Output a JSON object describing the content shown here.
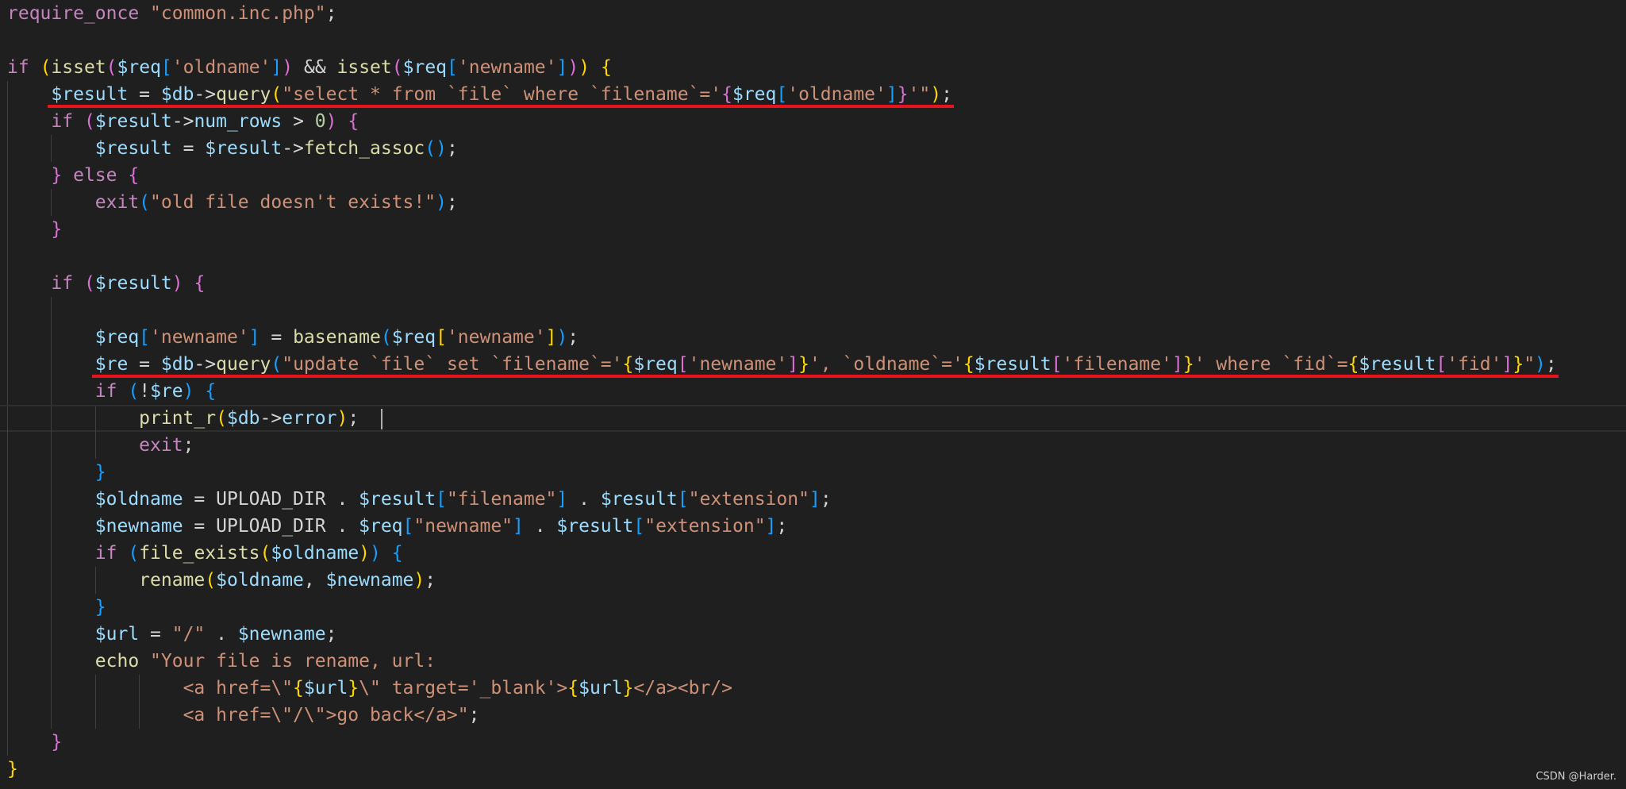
{
  "editor": {
    "current_line": 16,
    "lines": [
      {
        "tokens": [
          [
            "k",
            "require_once"
          ],
          [
            "p",
            " "
          ],
          [
            "s",
            "\"common.inc.php\""
          ],
          [
            "p",
            ";"
          ]
        ]
      },
      {
        "tokens": []
      },
      {
        "tokens": [
          [
            "k",
            "if"
          ],
          [
            "p",
            " "
          ],
          [
            "b1",
            "("
          ],
          [
            "f",
            "isset"
          ],
          [
            "b2",
            "("
          ],
          [
            "v",
            "$req"
          ],
          [
            "b3",
            "["
          ],
          [
            "s",
            "'oldname'"
          ],
          [
            "b3",
            "]"
          ],
          [
            "b2",
            ")"
          ],
          [
            "p",
            " && "
          ],
          [
            "f",
            "isset"
          ],
          [
            "b2",
            "("
          ],
          [
            "v",
            "$req"
          ],
          [
            "b3",
            "["
          ],
          [
            "s",
            "'newname'"
          ],
          [
            "b3",
            "]"
          ],
          [
            "b2",
            ")"
          ],
          [
            "b1",
            ")"
          ],
          [
            "p",
            " "
          ],
          [
            "b1",
            "{"
          ]
        ]
      },
      {
        "underlined": true,
        "tokens": [
          [
            "p",
            "    "
          ],
          [
            "v",
            "$result"
          ],
          [
            "p",
            " = "
          ],
          [
            "v",
            "$db"
          ],
          [
            "p",
            "->"
          ],
          [
            "f",
            "query"
          ],
          [
            "b1",
            "("
          ],
          [
            "s",
            "\"select * from `file` where `filename`='"
          ],
          [
            "b2",
            "{"
          ],
          [
            "v",
            "$req"
          ],
          [
            "b3",
            "["
          ],
          [
            "s",
            "'oldname'"
          ],
          [
            "b3",
            "]"
          ],
          [
            "b2",
            "}"
          ],
          [
            "s",
            "'\""
          ],
          [
            "b1",
            ")"
          ],
          [
            "p",
            ";"
          ]
        ]
      },
      {
        "tokens": [
          [
            "p",
            "    "
          ],
          [
            "k",
            "if"
          ],
          [
            "p",
            " "
          ],
          [
            "b2",
            "("
          ],
          [
            "v",
            "$result"
          ],
          [
            "p",
            "->"
          ],
          [
            "v",
            "num_rows"
          ],
          [
            "p",
            " > "
          ],
          [
            "n",
            "0"
          ],
          [
            "b2",
            ")"
          ],
          [
            "p",
            " "
          ],
          [
            "b2",
            "{"
          ]
        ]
      },
      {
        "tokens": [
          [
            "p",
            "        "
          ],
          [
            "v",
            "$result"
          ],
          [
            "p",
            " = "
          ],
          [
            "v",
            "$result"
          ],
          [
            "p",
            "->"
          ],
          [
            "f",
            "fetch_assoc"
          ],
          [
            "b3",
            "()"
          ],
          [
            "p",
            ";"
          ]
        ]
      },
      {
        "tokens": [
          [
            "p",
            "    "
          ],
          [
            "b2",
            "}"
          ],
          [
            "p",
            " "
          ],
          [
            "k",
            "else"
          ],
          [
            "p",
            " "
          ],
          [
            "b2",
            "{"
          ]
        ]
      },
      {
        "tokens": [
          [
            "p",
            "        "
          ],
          [
            "k",
            "exit"
          ],
          [
            "b3",
            "("
          ],
          [
            "s",
            "\"old file doesn't exists!\""
          ],
          [
            "b3",
            ")"
          ],
          [
            "p",
            ";"
          ]
        ]
      },
      {
        "tokens": [
          [
            "p",
            "    "
          ],
          [
            "b2",
            "}"
          ]
        ]
      },
      {
        "tokens": []
      },
      {
        "tokens": [
          [
            "p",
            "    "
          ],
          [
            "k",
            "if"
          ],
          [
            "p",
            " "
          ],
          [
            "b2",
            "("
          ],
          [
            "v",
            "$result"
          ],
          [
            "b2",
            ")"
          ],
          [
            "p",
            " "
          ],
          [
            "b2",
            "{"
          ]
        ]
      },
      {
        "tokens": []
      },
      {
        "tokens": [
          [
            "p",
            "        "
          ],
          [
            "v",
            "$req"
          ],
          [
            "b3",
            "["
          ],
          [
            "s",
            "'newname'"
          ],
          [
            "b3",
            "]"
          ],
          [
            "p",
            " = "
          ],
          [
            "f",
            "basename"
          ],
          [
            "b3",
            "("
          ],
          [
            "v",
            "$req"
          ],
          [
            "b1",
            "["
          ],
          [
            "s",
            "'newname'"
          ],
          [
            "b1",
            "]"
          ],
          [
            "b3",
            ")"
          ],
          [
            "p",
            ";"
          ]
        ]
      },
      {
        "underlined": true,
        "tokens": [
          [
            "p",
            "        "
          ],
          [
            "v",
            "$re"
          ],
          [
            "p",
            " = "
          ],
          [
            "v",
            "$db"
          ],
          [
            "p",
            "->"
          ],
          [
            "f",
            "query"
          ],
          [
            "b3",
            "("
          ],
          [
            "s",
            "\"update `file` set `filename`='"
          ],
          [
            "b1",
            "{"
          ],
          [
            "v",
            "$req"
          ],
          [
            "b2",
            "["
          ],
          [
            "s",
            "'newname'"
          ],
          [
            "b2",
            "]"
          ],
          [
            "b1",
            "}"
          ],
          [
            "s",
            "', `oldname`='"
          ],
          [
            "b1",
            "{"
          ],
          [
            "v",
            "$result"
          ],
          [
            "b2",
            "["
          ],
          [
            "s",
            "'filename'"
          ],
          [
            "b2",
            "]"
          ],
          [
            "b1",
            "}"
          ],
          [
            "s",
            "' where `fid`="
          ],
          [
            "b1",
            "{"
          ],
          [
            "v",
            "$result"
          ],
          [
            "b2",
            "["
          ],
          [
            "s",
            "'fid'"
          ],
          [
            "b2",
            "]"
          ],
          [
            "b1",
            "}"
          ],
          [
            "s",
            "\""
          ],
          [
            "b3",
            ")"
          ],
          [
            "p",
            ";"
          ]
        ]
      },
      {
        "tokens": [
          [
            "p",
            "        "
          ],
          [
            "k",
            "if"
          ],
          [
            "p",
            " "
          ],
          [
            "b3",
            "("
          ],
          [
            "p",
            "!"
          ],
          [
            "v",
            "$re"
          ],
          [
            "b3",
            ")"
          ],
          [
            "p",
            " "
          ],
          [
            "b3",
            "{"
          ]
        ]
      },
      {
        "cursor": true,
        "tokens": [
          [
            "p",
            "            "
          ],
          [
            "f",
            "print_r"
          ],
          [
            "b1",
            "("
          ],
          [
            "v",
            "$db"
          ],
          [
            "p",
            "->"
          ],
          [
            "v",
            "error"
          ],
          [
            "b1",
            ")"
          ],
          [
            "p",
            ";  "
          ]
        ]
      },
      {
        "tokens": [
          [
            "p",
            "            "
          ],
          [
            "k",
            "exit"
          ],
          [
            "p",
            ";"
          ]
        ]
      },
      {
        "tokens": [
          [
            "p",
            "        "
          ],
          [
            "b3",
            "}"
          ]
        ]
      },
      {
        "tokens": [
          [
            "p",
            "        "
          ],
          [
            "v",
            "$oldname"
          ],
          [
            "p",
            " = "
          ],
          [
            "c",
            "UPLOAD_DIR"
          ],
          [
            "p",
            " . "
          ],
          [
            "v",
            "$result"
          ],
          [
            "b3",
            "["
          ],
          [
            "s",
            "\"filename\""
          ],
          [
            "b3",
            "]"
          ],
          [
            "p",
            " . "
          ],
          [
            "v",
            "$result"
          ],
          [
            "b3",
            "["
          ],
          [
            "s",
            "\"extension\""
          ],
          [
            "b3",
            "]"
          ],
          [
            "p",
            ";"
          ]
        ]
      },
      {
        "tokens": [
          [
            "p",
            "        "
          ],
          [
            "v",
            "$newname"
          ],
          [
            "p",
            " = "
          ],
          [
            "c",
            "UPLOAD_DIR"
          ],
          [
            "p",
            " . "
          ],
          [
            "v",
            "$req"
          ],
          [
            "b3",
            "["
          ],
          [
            "s",
            "\"newname\""
          ],
          [
            "b3",
            "]"
          ],
          [
            "p",
            " . "
          ],
          [
            "v",
            "$result"
          ],
          [
            "b3",
            "["
          ],
          [
            "s",
            "\"extension\""
          ],
          [
            "b3",
            "]"
          ],
          [
            "p",
            ";"
          ]
        ]
      },
      {
        "tokens": [
          [
            "p",
            "        "
          ],
          [
            "k",
            "if"
          ],
          [
            "p",
            " "
          ],
          [
            "b3",
            "("
          ],
          [
            "f",
            "file_exists"
          ],
          [
            "b1",
            "("
          ],
          [
            "v",
            "$oldname"
          ],
          [
            "b1",
            ")"
          ],
          [
            "b3",
            ")"
          ],
          [
            "p",
            " "
          ],
          [
            "b3",
            "{"
          ]
        ]
      },
      {
        "tokens": [
          [
            "p",
            "            "
          ],
          [
            "f",
            "rename"
          ],
          [
            "b1",
            "("
          ],
          [
            "v",
            "$oldname"
          ],
          [
            "p",
            ", "
          ],
          [
            "v",
            "$newname"
          ],
          [
            "b1",
            ")"
          ],
          [
            "p",
            ";"
          ]
        ]
      },
      {
        "tokens": [
          [
            "p",
            "        "
          ],
          [
            "b3",
            "}"
          ]
        ]
      },
      {
        "tokens": [
          [
            "p",
            "        "
          ],
          [
            "v",
            "$url"
          ],
          [
            "p",
            " = "
          ],
          [
            "s",
            "\"/\""
          ],
          [
            "p",
            " . "
          ],
          [
            "v",
            "$newname"
          ],
          [
            "p",
            ";"
          ]
        ]
      },
      {
        "tokens": [
          [
            "p",
            "        "
          ],
          [
            "f",
            "echo"
          ],
          [
            "p",
            " "
          ],
          [
            "s",
            "\"Your file is rename, url:"
          ]
        ]
      },
      {
        "tokens": [
          [
            "p",
            "                "
          ],
          [
            "s",
            "<a href=\\\""
          ],
          [
            "b1",
            "{"
          ],
          [
            "v",
            "$url"
          ],
          [
            "b1",
            "}"
          ],
          [
            "s",
            "\\\" target='_blank'>"
          ],
          [
            "b1",
            "{"
          ],
          [
            "v",
            "$url"
          ],
          [
            "b1",
            "}"
          ],
          [
            "s",
            "</a><br/>"
          ]
        ]
      },
      {
        "tokens": [
          [
            "p",
            "                "
          ],
          [
            "s",
            "<a href=\\\"/\\\">go back</a>\""
          ],
          [
            "p",
            ";"
          ]
        ]
      },
      {
        "tokens": [
          [
            "p",
            "    "
          ],
          [
            "b2",
            "}"
          ]
        ]
      },
      {
        "tokens": [
          [
            "b1",
            "}"
          ]
        ]
      }
    ]
  },
  "watermark": "CSDN @Harder.",
  "colors": {
    "background": "#1f1f1f",
    "underline": "#e8141c",
    "keyword": "#c586c0",
    "function": "#dcdcaa",
    "variable": "#9cdcfe",
    "string": "#ce9178"
  }
}
